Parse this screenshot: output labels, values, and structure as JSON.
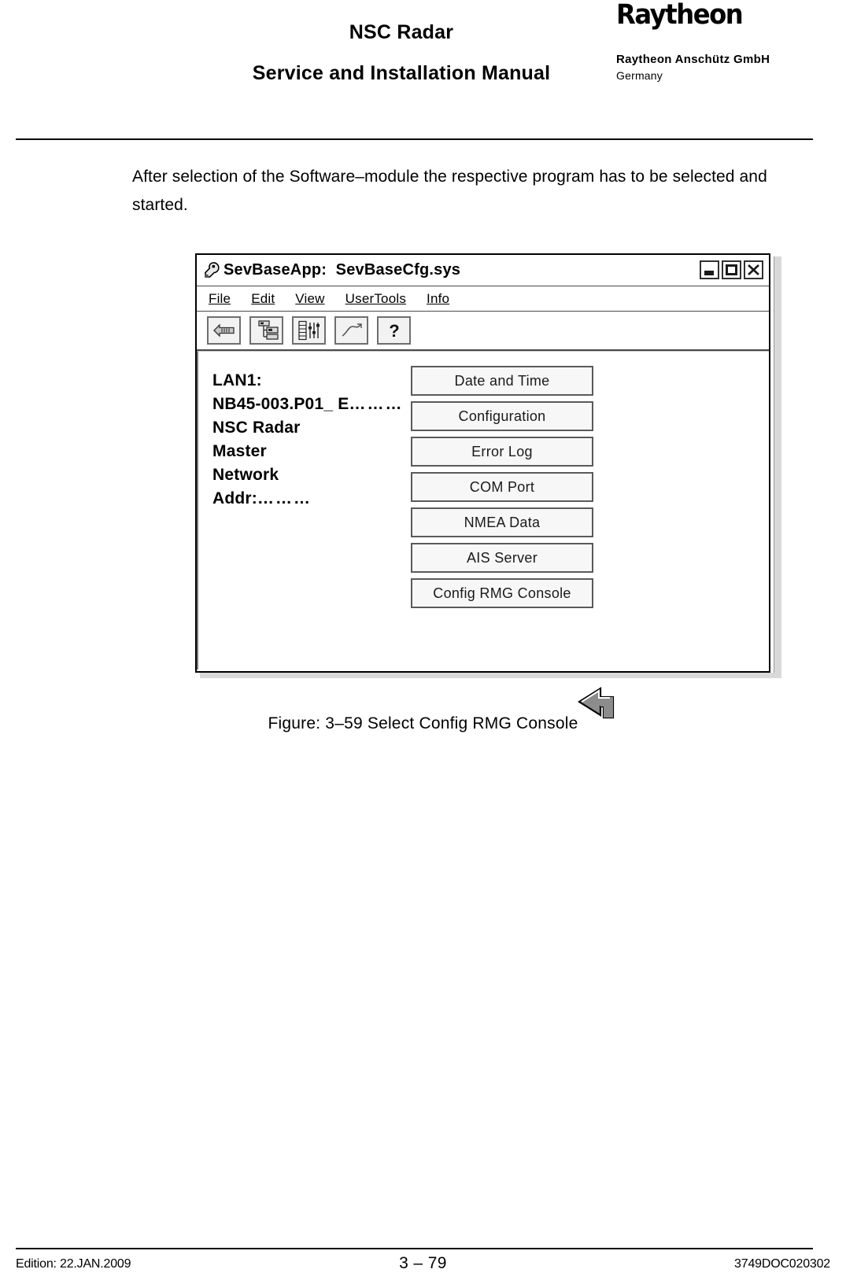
{
  "header": {
    "title_line_1": "NSC Radar",
    "title_line_2": "Service and Installation Manual",
    "brand_logo": "Raytheon",
    "company": "Raytheon Anschütz GmbH",
    "country": "Germany"
  },
  "body": {
    "paragraph": "After selection of the Software–module the respective program has to be selected and started."
  },
  "figure": {
    "caption": "Figure: 3–59 Select Config RMG Console",
    "app": {
      "title": "SevBaseApp:  SevBaseCfg.sys",
      "title_icon": "wrench-icon",
      "window_buttons": [
        {
          "name": "minimize",
          "glyph": "_"
        },
        {
          "name": "maximize",
          "glyph": "□"
        },
        {
          "name": "close",
          "glyph": "✕"
        }
      ],
      "menu": [
        {
          "label": "File",
          "mnemonic": "F"
        },
        {
          "label": "Edit",
          "mnemonic": "E"
        },
        {
          "label": "View",
          "mnemonic": "V"
        },
        {
          "label": "UserTools",
          "mnemonic": "U"
        },
        {
          "label": "Info",
          "mnemonic": "I"
        }
      ],
      "toolbar": [
        {
          "name": "back-arrow-icon"
        },
        {
          "name": "network-tree-icon"
        },
        {
          "name": "list-settings-icon"
        },
        {
          "name": "trend-graph-icon"
        },
        {
          "name": "help-question-icon"
        }
      ],
      "info_panel": {
        "lines": [
          "LAN1:",
          "NB45-003.P01_ E",
          "NSC Radar",
          "Master",
          "Network",
          "Addr:"
        ],
        "dots_after_line_2": "………",
        "dots_after_addr": "………"
      },
      "buttons": [
        "Date and Time",
        "Configuration",
        "Error Log",
        "COM Port",
        "NMEA Data",
        "AIS Server",
        "Config RMG Console"
      ],
      "cursor": "arrow-cursor"
    }
  },
  "footer": {
    "edition": "Edition: 22.JAN.2009",
    "page": "3 – 79",
    "doc_number": "3749DOC020302"
  }
}
